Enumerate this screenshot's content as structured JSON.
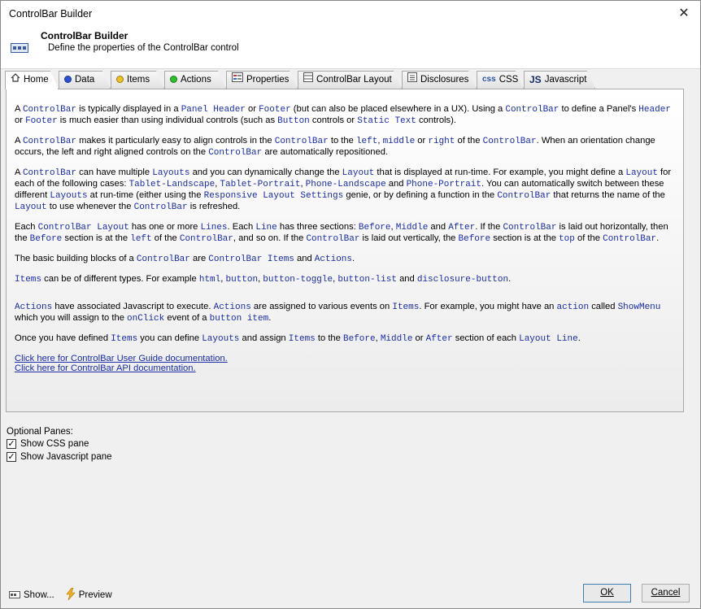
{
  "window": {
    "title": "ControlBar Builder"
  },
  "header": {
    "title": "ControlBar Builder",
    "subtitle": "Define the properties of the ControlBar control"
  },
  "tabs": [
    {
      "label": "Home",
      "icon": "house-icon"
    },
    {
      "label": "Data",
      "icon": "blue-dot-icon",
      "color": "#2a52d8"
    },
    {
      "label": "Items",
      "icon": "yellow-dot-icon",
      "color": "#f0c020"
    },
    {
      "label": "Actions",
      "icon": "green-dot-icon",
      "color": "#2cc02c"
    },
    {
      "label": "Properties",
      "icon": "properties-icon"
    },
    {
      "label": "ControlBar Layout",
      "icon": "layout-icon"
    },
    {
      "label": "Disclosures",
      "icon": "disclosures-icon"
    },
    {
      "label": "CSS",
      "icon": "css-icon",
      "icon_text": "css"
    },
    {
      "label": "Javascript",
      "icon": "js-icon",
      "icon_text": "JS"
    }
  ],
  "content": {
    "p1": [
      "A ",
      "ControlBar",
      " is typically displayed in a ",
      "Panel Header",
      " or ",
      "Footer",
      " (but can also be placed elsewhere in a UX). Using a ",
      "ControlBar",
      " to define a Panel's ",
      "Header",
      " or ",
      "Footer",
      " is much easier than using individual controls (such as ",
      "Button",
      " controls or ",
      "Static Text",
      " controls)."
    ],
    "p2": [
      "A ",
      "ControlBar",
      " makes it particularly easy to align controls in the ",
      "ControlBar",
      " to the ",
      "left",
      ", ",
      "middle",
      " or ",
      "right",
      " of the ",
      "ControlBar",
      ". When an orientation change occurs, the left and right aligned controls  on the ",
      "ControlBar",
      " are automatically repositioned."
    ],
    "p3": [
      "A ",
      "ControlBar",
      " can have multiple ",
      "Layouts",
      " and you can dynamically change the ",
      "Layout",
      " that is displayed at run-time. For example, you might define a ",
      "Layout",
      " for each of the following cases: ",
      "Tablet-Landscape",
      ", ",
      "Tablet-Portrait",
      ", ",
      "Phone-Landscape",
      " and ",
      "Phone-Portrait",
      ". You can automatically switch between these different ",
      "Layouts",
      " at run-time (either using the ",
      "Responsive Layout Settings",
      " genie, or by defining a function in the ",
      "ControlBar",
      " that returns the name of the ",
      "Layout",
      " to use whenever the ",
      "ControlBar",
      " is refreshed."
    ],
    "p4": [
      "Each ",
      "ControlBar Layout",
      " has one or more ",
      "Lines",
      ". Each ",
      "Line",
      " has three sections: ",
      "Before",
      ", ",
      "Middle",
      " and ",
      "After",
      ". If the ",
      "ControlBar",
      " is laid out horizontally, then the ",
      "Before",
      " section is at the ",
      "left",
      " of the ",
      "ControlBar",
      ", and so on. If the ",
      "ControlBar",
      " is laid out vertically, the ",
      "Before",
      " section is at the ",
      "top",
      " of the ",
      "ControlBar",
      "."
    ],
    "p5": [
      "The basic building blocks of a ",
      "ControlBar",
      " are ",
      "ControlBar Items",
      " and ",
      "Actions",
      "."
    ],
    "p6": [
      "",
      "Items",
      " can be of different types. For example ",
      "html",
      ", ",
      "button",
      ", ",
      "button-toggle",
      ", ",
      "button-list",
      " and ",
      "disclosure-button",
      "."
    ],
    "p7": [
      "",
      "Actions",
      " have associated Javascript to execute. ",
      "Actions",
      " are assigned to various events on ",
      "Items",
      ". For example, you might have an ",
      "action",
      " called ",
      "ShowMenu",
      " which you will assign to the ",
      "onClick",
      " event of a ",
      "button item",
      "."
    ],
    "p8": [
      "Once you have defined ",
      "Items",
      " you can define ",
      "Layouts",
      " and assign ",
      "Items",
      " to the ",
      "Before",
      ", ",
      "Middle",
      " or ",
      "After",
      " section of each ",
      "Layout Line",
      "."
    ],
    "link1": "Click here for ControlBar User Guide documentation.",
    "link2": "Click here for ControlBar API documentation."
  },
  "optional": {
    "label": "Optional Panes:",
    "css": {
      "label": "Show CSS pane",
      "checked": true
    },
    "js": {
      "label": "Show Javascript pane",
      "checked": true
    }
  },
  "footer": {
    "show_label": "Show...",
    "preview_label": "Preview",
    "ok_label": "OK",
    "cancel_label": "Cancel"
  },
  "colors": {
    "code": "#1a2ca8",
    "accent": "#3c7fb1"
  }
}
